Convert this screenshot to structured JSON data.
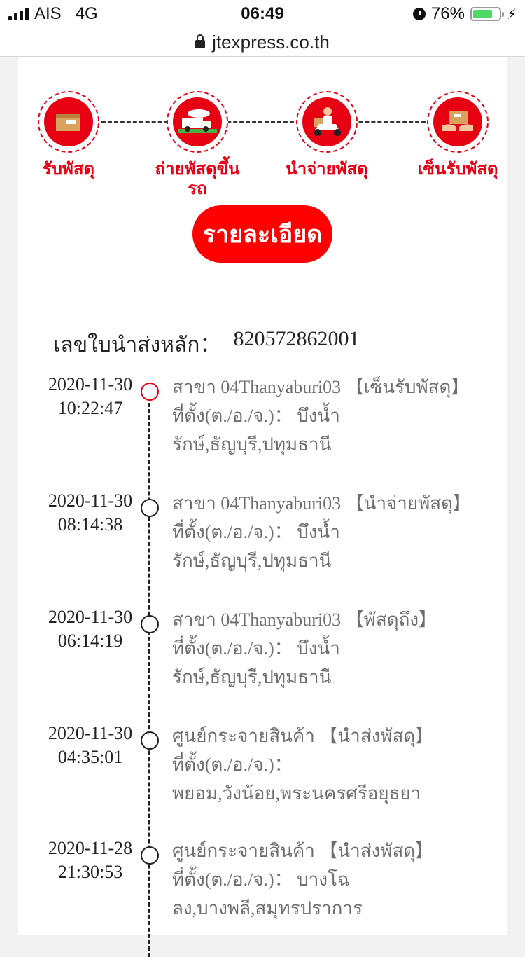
{
  "status_bar": {
    "carrier": "AIS",
    "network": "4G",
    "time": "06:49",
    "battery": "76%"
  },
  "browser": {
    "url": "jtexpress.co.th"
  },
  "steps": [
    {
      "label": "รับพัสดุ",
      "icon": "parcel-icon"
    },
    {
      "label": "ถ่ายพัสดุขึ้นรถ",
      "icon": "truck-icon"
    },
    {
      "label": "นำจ่ายพัสดุ",
      "icon": "scooter-icon"
    },
    {
      "label": "เซ็นรับพัสดุ",
      "icon": "handover-icon"
    }
  ],
  "detail_button": "รายละเอียด",
  "main_tracking": {
    "label": "เลขใบนำส่งหลัก：",
    "number": "820572862001"
  },
  "events": [
    {
      "date": "2020-11-30",
      "time": "10:22:47",
      "line1": "สาขา 04Thanyaburi03 【เซ็นรับพัสดุ】",
      "line2": "ที่ตั้ง(ต./อ./จ.)：  บึงน้ำรักษ์,ธัญบุรี,ปทุมธานี"
    },
    {
      "date": "2020-11-30",
      "time": "08:14:38",
      "line1": "สาขา 04Thanyaburi03 【นำจ่ายพัสดุ】",
      "line2": "ที่ตั้ง(ต./อ./จ.)：  บึงน้ำรักษ์,ธัญบุรี,ปทุมธานี"
    },
    {
      "date": "2020-11-30",
      "time": "06:14:19",
      "line1": "สาขา 04Thanyaburi03 【พัสดุถึง】",
      "line2": "ที่ตั้ง(ต./อ./จ.)：  บึงน้ำรักษ์,ธัญบุรี,ปทุมธานี"
    },
    {
      "date": "2020-11-30",
      "time": "04:35:01",
      "line1": "ศูนย์กระจายสินค้า 【นำส่งพัสดุ】",
      "line2": "ที่ตั้ง(ต./อ./จ.)：  พยอม,วังน้อย,พระนครศรีอยุธยา"
    },
    {
      "date": "2020-11-28",
      "time": "21:30:53",
      "line1": "ศูนย์กระจายสินค้า 【นำส่งพัสดุ】",
      "line2": "ที่ตั้ง(ต./อ./จ.)：  บางโฉลง,บางพลี,สมุทรปราการ"
    }
  ],
  "colors": {
    "brand_red": "#e60012",
    "button_red": "#fe0000"
  }
}
